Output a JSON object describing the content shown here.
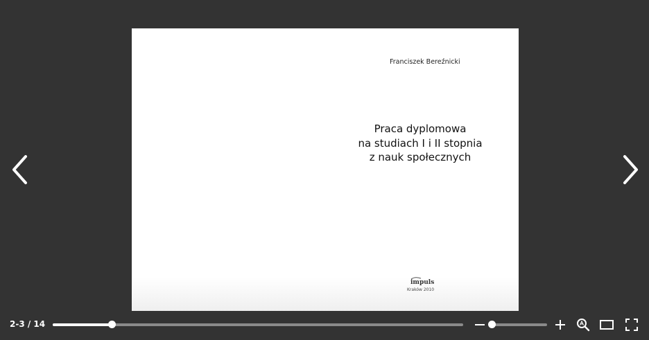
{
  "document": {
    "author": "Franciszek Bereźnicki",
    "title_lines": [
      "Praca dyplomowa",
      "na studiach I i II stopnia",
      "z nauk społecznych"
    ],
    "publisher": "impuls",
    "place_year": "Kraków 2010"
  },
  "toolbar": {
    "page_counter": "2-3 / 14",
    "progress": 0.143,
    "zoom_level": 0.05
  },
  "icons": {
    "prev": "chevron-left-icon",
    "next": "chevron-right-icon",
    "zoom_out": "minus-icon",
    "zoom_in": "plus-icon",
    "search": "search-icon",
    "single_page": "single-page-icon",
    "fullscreen": "fullscreen-icon"
  },
  "colors": {
    "background": "#333333",
    "page": "#ffffff",
    "track": "#8a8a8a",
    "accent": "#ffffff"
  }
}
